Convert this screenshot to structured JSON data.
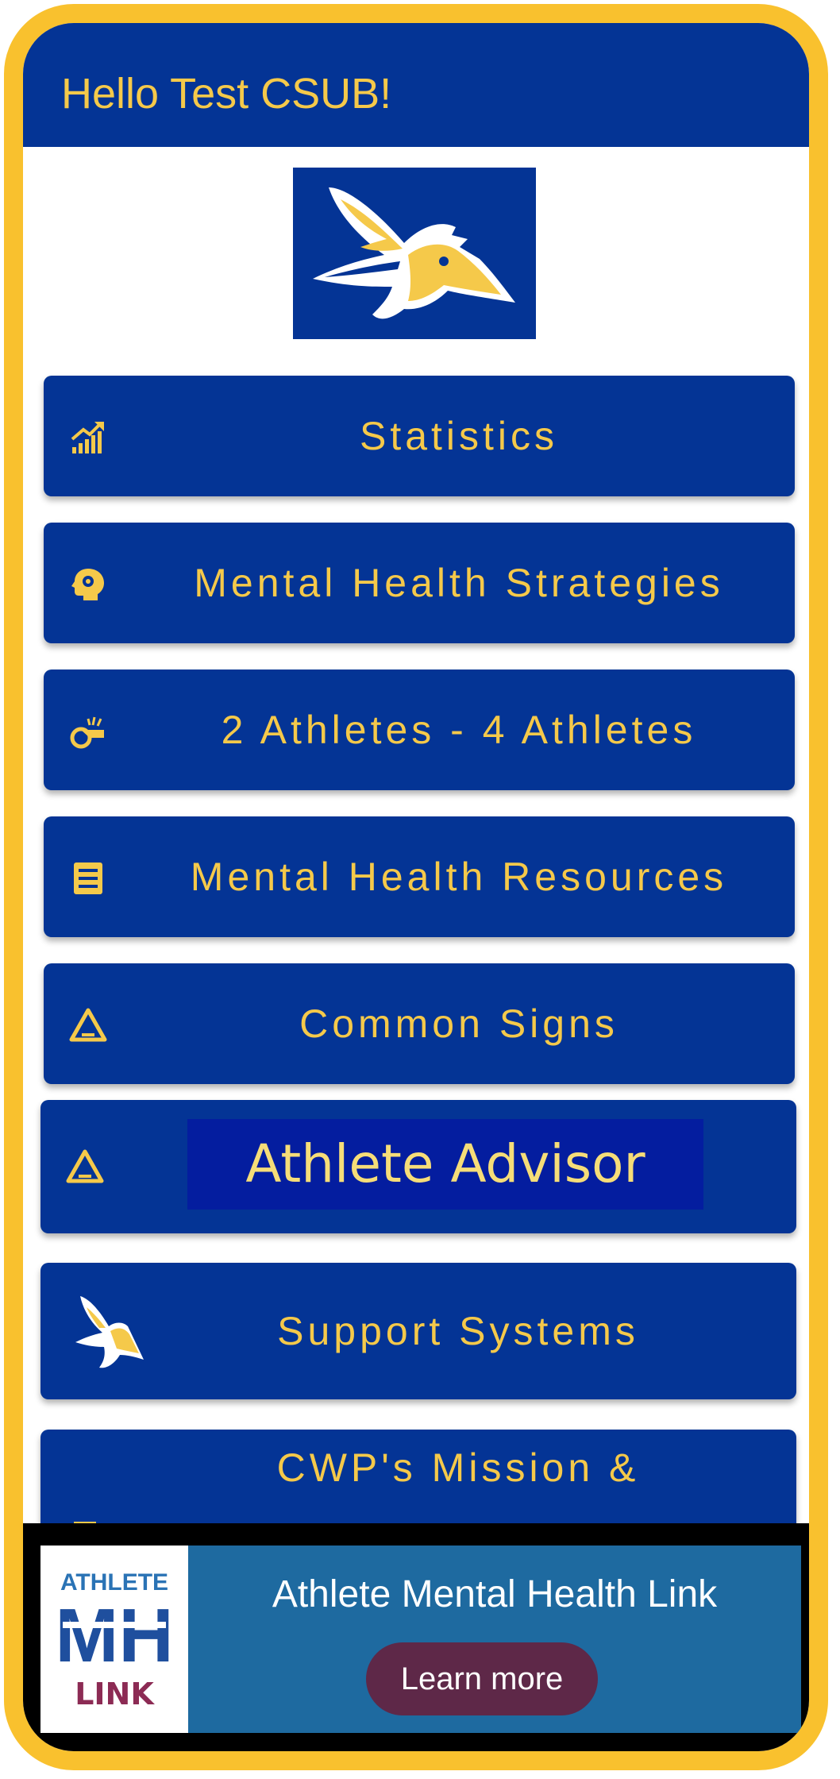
{
  "header": {
    "greeting": "Hello Test CSUB!"
  },
  "logo": {
    "name": "roadrunner-mascot-logo"
  },
  "menu": [
    {
      "label": "Statistics",
      "icon": "chart-trend-icon"
    },
    {
      "label": "Mental Health Strategies",
      "icon": "brain-gear-icon"
    },
    {
      "label": "2 Athletes - 4 Athletes",
      "icon": "whistle-icon"
    },
    {
      "label": "Mental Health Resources",
      "icon": "list-icon"
    },
    {
      "label": "Common Signs",
      "icon": "warning-triangle-icon"
    },
    {
      "label": "Athlete Advisor",
      "icon": "warning-triangle-icon"
    },
    {
      "label": "Support Systems",
      "icon": "roadrunner-icon"
    },
    {
      "label": "CWP's Mission &",
      "icon": "trophy-icon"
    }
  ],
  "ad": {
    "title": "Athlete Mental Health Link",
    "button": "Learn more",
    "logo_text": {
      "top": "ATHLETE",
      "middle": "MH",
      "bottom": "LINK"
    }
  },
  "colors": {
    "frame": "#f9c12e",
    "primary": "#043495",
    "accent": "#f5c94a",
    "ad_background": "#1e6aa0",
    "ad_button": "#5e2848"
  }
}
